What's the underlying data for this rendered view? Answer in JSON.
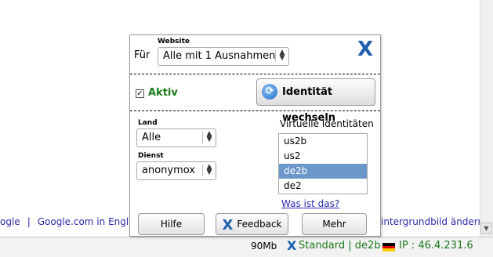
{
  "page": {
    "footer_links": [
      "ogle",
      "Google.com in Englis"
    ],
    "footer_separator": "|",
    "footer_right_link": "intergrundbild ändern"
  },
  "statusbar": {
    "memory": "90Mb",
    "logo": "X",
    "mode": "Standard | de2b",
    "ip": "IP : 46.4.231.6",
    "flag_colors": [
      "#000000",
      "#dd0000",
      "#ffce00"
    ]
  },
  "popup": {
    "logo": "X",
    "fuer_label": "Für",
    "website_label": "Website",
    "website_select": "Alle mit 1 Ausnahmen",
    "aktiv_label": "Aktiv",
    "aktiv_checked": "✓",
    "identity_button": "Identität wechseln",
    "land_label": "Land",
    "land_select": "Alle",
    "dienst_label": "Dienst",
    "dienst_select": "anonymox",
    "virtual_identities_label": "Virtuelle Identitäten",
    "identities": [
      "us2b",
      "us2",
      "de2b",
      "de2"
    ],
    "selected_identity": "de2b",
    "was_ist_das": "Was ist das?",
    "buttons": {
      "hilfe": "Hilfe",
      "feedback": "Feedback",
      "mehr": "Mehr"
    },
    "accent_color": "#1f5fae",
    "active_color": "#1a7a1a"
  }
}
